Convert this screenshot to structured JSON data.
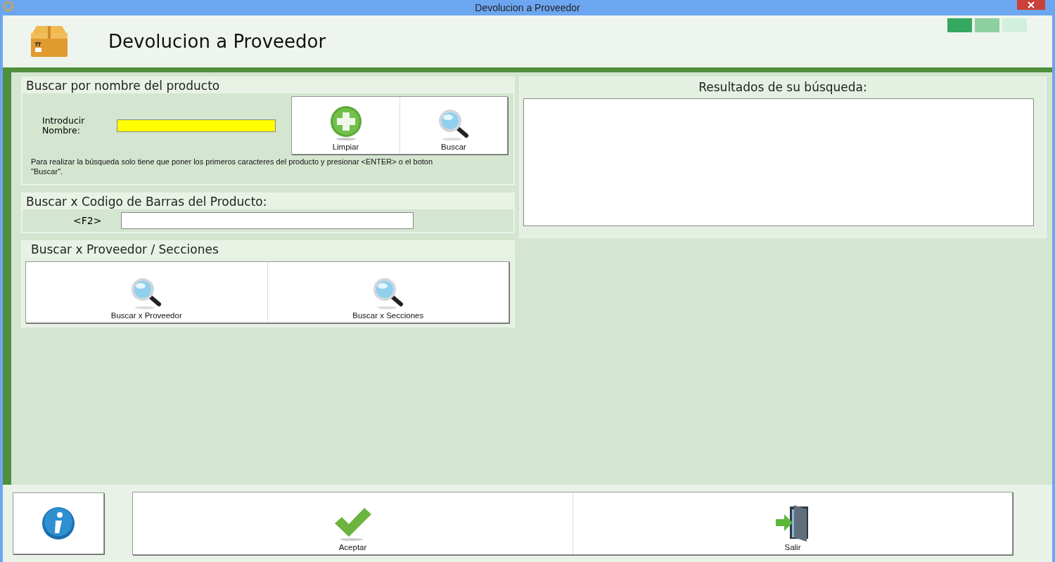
{
  "window": {
    "title": "Devolucion a Proveedor"
  },
  "header": {
    "title": "Devolucion a Proveedor"
  },
  "name_search": {
    "title": "Buscar por nombre del producto",
    "label": "Introducir Nombre:",
    "focused": true,
    "buttons": [
      {
        "kind": "plus",
        "label": "Limpiar"
      },
      {
        "kind": "search",
        "label": "Buscar"
      }
    ],
    "hint": "Para realizar la búsqueda solo tiene que poner los primeros caracteres del producto y presionar <ENTER> o el boton \"Buscar\"."
  },
  "barcode_search": {
    "title": "Buscar x Codigo de Barras del Producto:",
    "key_label": "<F2>"
  },
  "supplier_search": {
    "title": "Buscar x Proveedor / Secciones",
    "buttons": [
      {
        "kind": "search",
        "label": "Buscar x Proveedor"
      },
      {
        "kind": "search",
        "label": "Buscar x Secciones"
      }
    ]
  },
  "results": {
    "title": "Resultados de su búsqueda:"
  },
  "footer": {
    "buttons": [
      {
        "kind": "info"
      },
      {
        "kind": "check",
        "label": "Aceptar"
      },
      {
        "kind": "exit",
        "label": "Salir"
      }
    ]
  }
}
